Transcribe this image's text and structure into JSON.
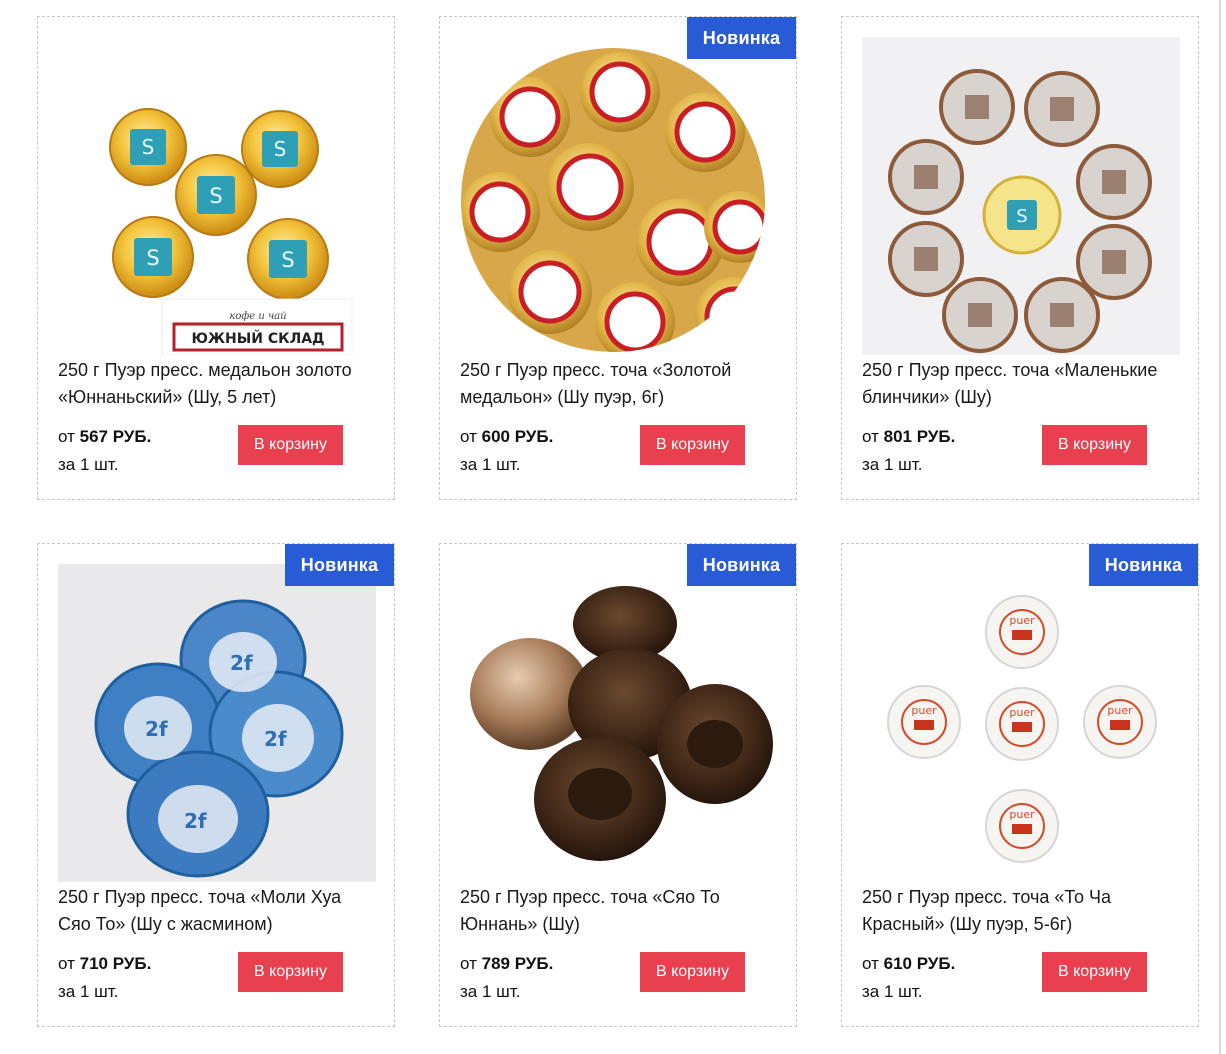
{
  "products": [
    {
      "title": "250 г Пуэр пресс. медальон золото «Юннаньский» (Шу, 5 лет)",
      "price_prefix": "от",
      "price": "567 РУБ.",
      "unit": "за 1 шт.",
      "button": "В корзину",
      "badge": "",
      "image": {
        "watermark_top": "кофе и чай",
        "watermark_main": "ЮЖНЫЙ СКЛАД"
      }
    },
    {
      "title": "250 г Пуэр пресс. точа «Золотой медальон» (Шу пуэр, 6г)",
      "price_prefix": "от",
      "price": "600 РУБ.",
      "unit": "за 1 шт.",
      "button": "В корзину",
      "badge": "Новинка"
    },
    {
      "title": "250 г Пуэр пресс. точа «Маленькие блинчики» (Шу)",
      "price_prefix": "от",
      "price": "801 РУБ.",
      "unit": "за 1 шт.",
      "button": "В корзину",
      "badge": ""
    },
    {
      "title": "250 г Пуэр пресс. точа «Моли Хуа Сяо То» (Шу с жасмином)",
      "price_prefix": "от",
      "price": "710 РУБ.",
      "unit": "за 1 шт.",
      "button": "В корзину",
      "badge": "Новинка"
    },
    {
      "title": "250 г Пуэр пресс. точа «Сяо То Юннань» (Шу)",
      "price_prefix": "от",
      "price": "789 РУБ.",
      "unit": "за 1 шт.",
      "button": "В корзину",
      "badge": "Новинка"
    },
    {
      "title": "250 г Пуэр пресс. точа «То Ча Красный» (Шу пуэр, 5-6г)",
      "price_prefix": "от",
      "price": "610 РУБ.",
      "unit": "за 1 шт.",
      "button": "В корзину",
      "badge": "Новинка",
      "image": {
        "label": "puer"
      }
    }
  ],
  "colors": {
    "badge": "#2a5bd7",
    "button": "#e8404f",
    "card_border": "#c8c8c8"
  }
}
